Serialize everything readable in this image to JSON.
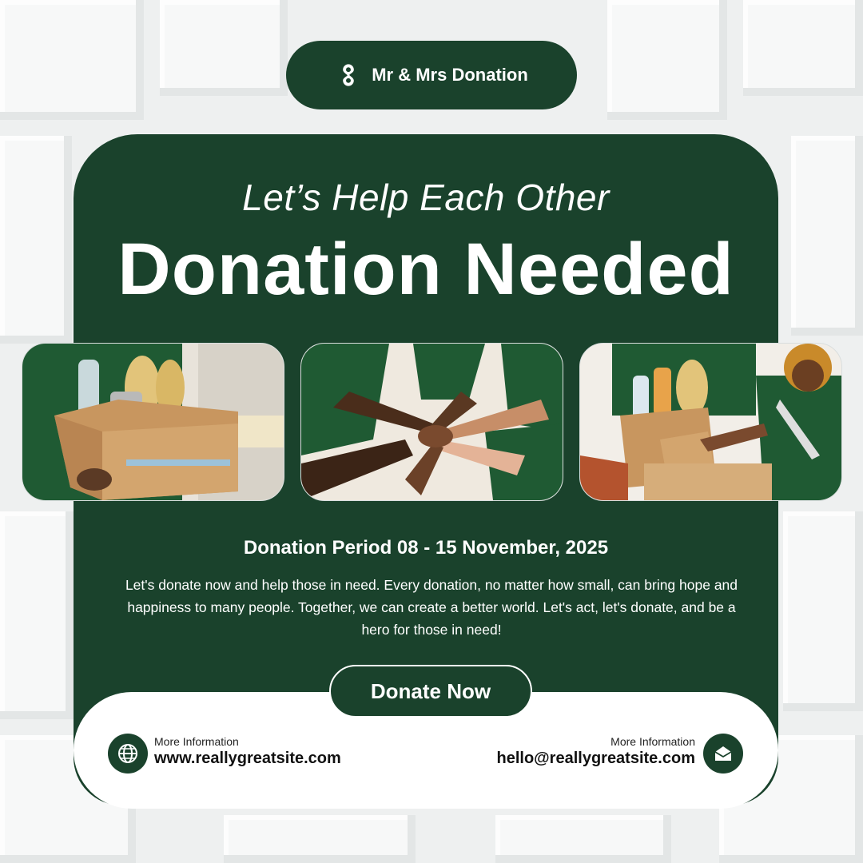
{
  "brand": {
    "name": "Mr & Mrs Donation",
    "icon": "swirl-logo-icon"
  },
  "tagline": "Let’s Help Each Other",
  "title": "Donation Needed",
  "photos": [
    {
      "description_icon": "food-box-photo"
    },
    {
      "description_icon": "stacked-hands-photo"
    },
    {
      "description_icon": "handing-box-photo"
    }
  ],
  "period": "Donation Period 08 - 15 November, 2025",
  "description": "Let's donate now and help those in need. Every donation, no matter how small, can bring hope and happiness to many people. Together, we can create a better world. Let's act, let's donate, and be a hero for those in need!",
  "cta": {
    "label": "Donate Now"
  },
  "contact": {
    "website": {
      "label": "More Information",
      "value": "www.reallygreatsite.com",
      "icon": "globe-icon"
    },
    "email": {
      "label": "More Information",
      "value": "hello@reallygreatsite.com",
      "icon": "envelope-icon"
    }
  },
  "colors": {
    "primary": "#1a422c",
    "background": "#eef0f0",
    "text_light": "#ffffff"
  }
}
